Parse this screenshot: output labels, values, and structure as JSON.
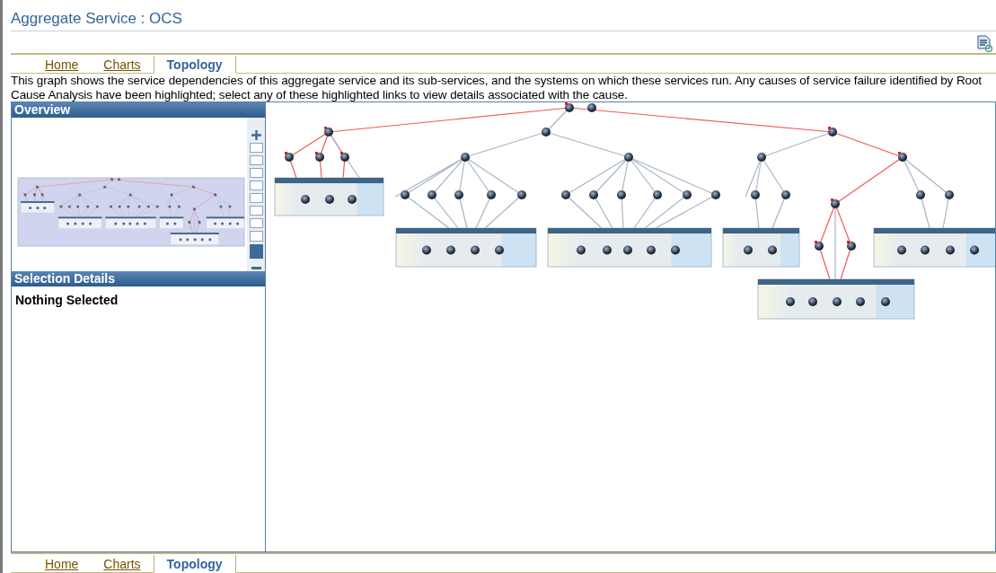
{
  "page_title": "Aggregate Service : OCS",
  "tabs": [
    {
      "label": "Home",
      "selected": false
    },
    {
      "label": "Charts",
      "selected": false
    },
    {
      "label": "Topology",
      "selected": true
    }
  ],
  "description": "This graph shows the service dependencies of this aggregate service and its sub-services, and the systems on which these services run. Any causes of service failure identified by Root Cause Analysis have been highlighted; select any of these highlighted links to view details associated with the cause.",
  "overview": {
    "title": "Overview"
  },
  "selection_details": {
    "title": "Selection Details",
    "message": "Nothing Selected"
  },
  "bottom_tabs": [
    {
      "label": "Home",
      "selected": false
    },
    {
      "label": "Charts",
      "selected": false
    },
    {
      "label": "Topology",
      "selected": true
    }
  ]
}
